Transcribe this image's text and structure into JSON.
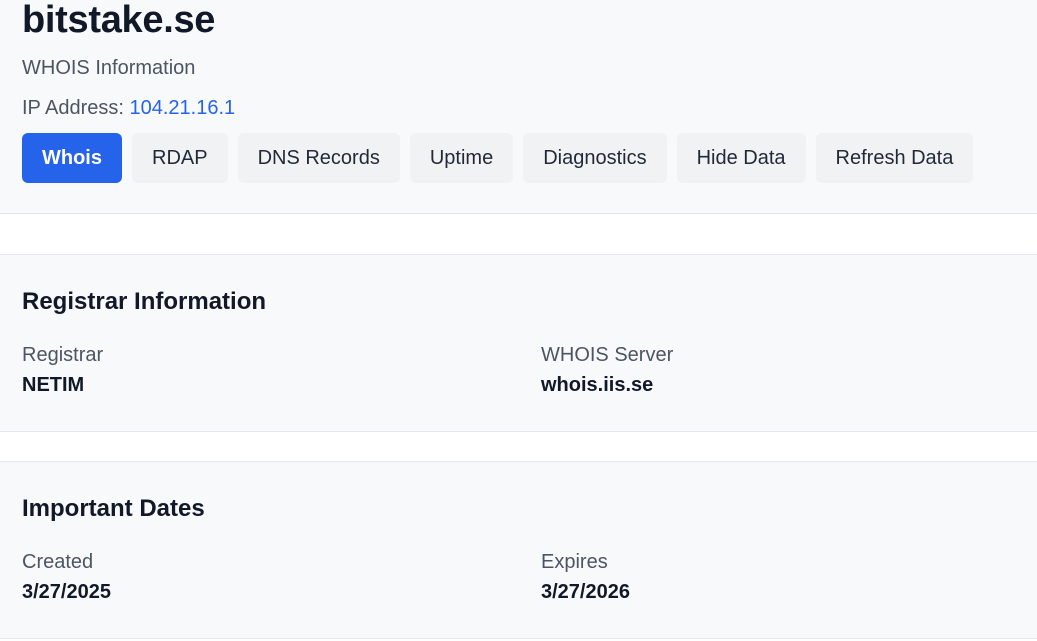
{
  "header": {
    "title": "bitstake.se",
    "subtitle": "WHOIS Information",
    "ip_label": "IP Address:",
    "ip_value": "104.21.16.1"
  },
  "tabs": [
    {
      "label": "Whois",
      "active": true
    },
    {
      "label": "RDAP",
      "active": false
    },
    {
      "label": "DNS Records",
      "active": false
    },
    {
      "label": "Uptime",
      "active": false
    },
    {
      "label": "Diagnostics",
      "active": false
    },
    {
      "label": "Hide Data",
      "active": false
    },
    {
      "label": "Refresh Data",
      "active": false
    }
  ],
  "registrar_section": {
    "title": "Registrar Information",
    "registrar_label": "Registrar",
    "registrar_value": "NETIM",
    "whois_server_label": "WHOIS Server",
    "whois_server_value": "whois.iis.se"
  },
  "dates_section": {
    "title": "Important Dates",
    "created_label": "Created",
    "created_value": "3/27/2025",
    "expires_label": "Expires",
    "expires_value": "3/27/2026"
  },
  "colors": {
    "accent": "#2563eb",
    "panel_background": "#f8f9fb",
    "tab_background": "#f1f2f4"
  }
}
